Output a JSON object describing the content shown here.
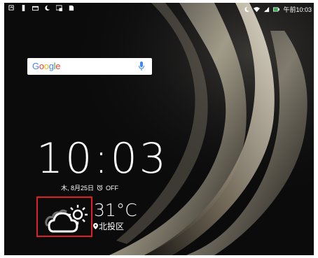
{
  "status_bar": {
    "time": "午前10:03",
    "left_icons": [
      "notification-icon",
      "phone-icon",
      "message-icon",
      "moon-icon",
      "cast-icon",
      "sdcard-icon"
    ],
    "right_icons": [
      "moon-icon",
      "wifi-icon",
      "signal-icon",
      "battery-icon"
    ]
  },
  "search": {
    "logo": "Google"
  },
  "clock": {
    "time": "10:03",
    "date": "木, 8月25日",
    "alarm": "OFF"
  },
  "weather": {
    "temperature": "31°C",
    "location": "北投区",
    "icon": "partly-cloudy-icon"
  },
  "colors": {
    "highlight_border": "#e02020"
  }
}
